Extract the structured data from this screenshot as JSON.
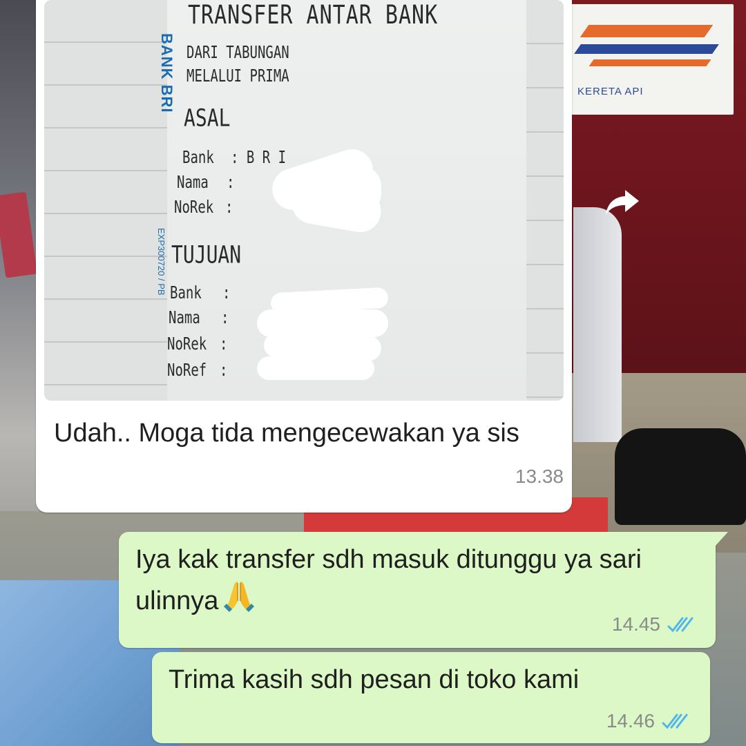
{
  "background": {
    "sign_text": "KERETA API"
  },
  "receipt": {
    "title": "TRANSFER ANTAR BANK",
    "brand": "BANK BRI",
    "code": "EXP300720 / PB",
    "line1": "DARI TABUNGAN",
    "line2": "MELALUI PRIMA",
    "asal_heading": "ASAL",
    "asal_rows": [
      {
        "label": "Bank",
        "value": ": B R I"
      },
      {
        "label": "Nama",
        "value": ":"
      },
      {
        "label": "NoRek",
        "value": ":"
      }
    ],
    "tujuan_heading": "TUJUAN",
    "tujuan_rows": [
      {
        "label": "Bank",
        "value": ":"
      },
      {
        "label": "Nama",
        "value": ":"
      },
      {
        "label": "NoRek",
        "value": ":"
      },
      {
        "label": "NoRef",
        "value": ":"
      }
    ]
  },
  "messages": {
    "incoming": {
      "text": "Udah..  Moga tida mengecewakan ya sis",
      "time": "13.38"
    },
    "outgoing_1": {
      "text": "Iya kak transfer sdh masuk ditunggu ya sari ulinnya",
      "emoji_icon": "folded-hands-icon",
      "time": "14.45",
      "status": "read-double-check-icon"
    },
    "outgoing_2": {
      "text": "Trima kasih sdh pesan di toko kami",
      "time": "14.46",
      "status": "read-double-check-icon"
    }
  },
  "colors": {
    "bubble_in": "#ffffff",
    "bubble_out": "#dcf8c6",
    "read_ticks": "#4fb6ec",
    "timestamp": "#8a8a8a"
  }
}
